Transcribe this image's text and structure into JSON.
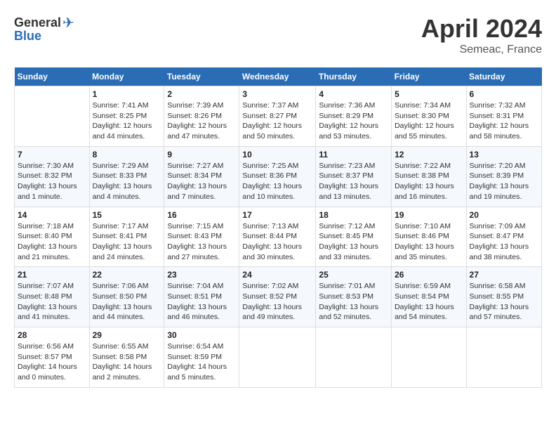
{
  "header": {
    "logo": {
      "general": "General",
      "blue": "Blue"
    },
    "month": "April 2024",
    "location": "Semeac, France"
  },
  "weekdays": [
    "Sunday",
    "Monday",
    "Tuesday",
    "Wednesday",
    "Thursday",
    "Friday",
    "Saturday"
  ],
  "weeks": [
    [
      {
        "day": "",
        "sunrise": "",
        "sunset": "",
        "daylight": ""
      },
      {
        "day": "1",
        "sunrise": "Sunrise: 7:41 AM",
        "sunset": "Sunset: 8:25 PM",
        "daylight": "Daylight: 12 hours and 44 minutes."
      },
      {
        "day": "2",
        "sunrise": "Sunrise: 7:39 AM",
        "sunset": "Sunset: 8:26 PM",
        "daylight": "Daylight: 12 hours and 47 minutes."
      },
      {
        "day": "3",
        "sunrise": "Sunrise: 7:37 AM",
        "sunset": "Sunset: 8:27 PM",
        "daylight": "Daylight: 12 hours and 50 minutes."
      },
      {
        "day": "4",
        "sunrise": "Sunrise: 7:36 AM",
        "sunset": "Sunset: 8:29 PM",
        "daylight": "Daylight: 12 hours and 53 minutes."
      },
      {
        "day": "5",
        "sunrise": "Sunrise: 7:34 AM",
        "sunset": "Sunset: 8:30 PM",
        "daylight": "Daylight: 12 hours and 55 minutes."
      },
      {
        "day": "6",
        "sunrise": "Sunrise: 7:32 AM",
        "sunset": "Sunset: 8:31 PM",
        "daylight": "Daylight: 12 hours and 58 minutes."
      }
    ],
    [
      {
        "day": "7",
        "sunrise": "Sunrise: 7:30 AM",
        "sunset": "Sunset: 8:32 PM",
        "daylight": "Daylight: 13 hours and 1 minute."
      },
      {
        "day": "8",
        "sunrise": "Sunrise: 7:29 AM",
        "sunset": "Sunset: 8:33 PM",
        "daylight": "Daylight: 13 hours and 4 minutes."
      },
      {
        "day": "9",
        "sunrise": "Sunrise: 7:27 AM",
        "sunset": "Sunset: 8:34 PM",
        "daylight": "Daylight: 13 hours and 7 minutes."
      },
      {
        "day": "10",
        "sunrise": "Sunrise: 7:25 AM",
        "sunset": "Sunset: 8:36 PM",
        "daylight": "Daylight: 13 hours and 10 minutes."
      },
      {
        "day": "11",
        "sunrise": "Sunrise: 7:23 AM",
        "sunset": "Sunset: 8:37 PM",
        "daylight": "Daylight: 13 hours and 13 minutes."
      },
      {
        "day": "12",
        "sunrise": "Sunrise: 7:22 AM",
        "sunset": "Sunset: 8:38 PM",
        "daylight": "Daylight: 13 hours and 16 minutes."
      },
      {
        "day": "13",
        "sunrise": "Sunrise: 7:20 AM",
        "sunset": "Sunset: 8:39 PM",
        "daylight": "Daylight: 13 hours and 19 minutes."
      }
    ],
    [
      {
        "day": "14",
        "sunrise": "Sunrise: 7:18 AM",
        "sunset": "Sunset: 8:40 PM",
        "daylight": "Daylight: 13 hours and 21 minutes."
      },
      {
        "day": "15",
        "sunrise": "Sunrise: 7:17 AM",
        "sunset": "Sunset: 8:41 PM",
        "daylight": "Daylight: 13 hours and 24 minutes."
      },
      {
        "day": "16",
        "sunrise": "Sunrise: 7:15 AM",
        "sunset": "Sunset: 8:43 PM",
        "daylight": "Daylight: 13 hours and 27 minutes."
      },
      {
        "day": "17",
        "sunrise": "Sunrise: 7:13 AM",
        "sunset": "Sunset: 8:44 PM",
        "daylight": "Daylight: 13 hours and 30 minutes."
      },
      {
        "day": "18",
        "sunrise": "Sunrise: 7:12 AM",
        "sunset": "Sunset: 8:45 PM",
        "daylight": "Daylight: 13 hours and 33 minutes."
      },
      {
        "day": "19",
        "sunrise": "Sunrise: 7:10 AM",
        "sunset": "Sunset: 8:46 PM",
        "daylight": "Daylight: 13 hours and 35 minutes."
      },
      {
        "day": "20",
        "sunrise": "Sunrise: 7:09 AM",
        "sunset": "Sunset: 8:47 PM",
        "daylight": "Daylight: 13 hours and 38 minutes."
      }
    ],
    [
      {
        "day": "21",
        "sunrise": "Sunrise: 7:07 AM",
        "sunset": "Sunset: 8:48 PM",
        "daylight": "Daylight: 13 hours and 41 minutes."
      },
      {
        "day": "22",
        "sunrise": "Sunrise: 7:06 AM",
        "sunset": "Sunset: 8:50 PM",
        "daylight": "Daylight: 13 hours and 44 minutes."
      },
      {
        "day": "23",
        "sunrise": "Sunrise: 7:04 AM",
        "sunset": "Sunset: 8:51 PM",
        "daylight": "Daylight: 13 hours and 46 minutes."
      },
      {
        "day": "24",
        "sunrise": "Sunrise: 7:02 AM",
        "sunset": "Sunset: 8:52 PM",
        "daylight": "Daylight: 13 hours and 49 minutes."
      },
      {
        "day": "25",
        "sunrise": "Sunrise: 7:01 AM",
        "sunset": "Sunset: 8:53 PM",
        "daylight": "Daylight: 13 hours and 52 minutes."
      },
      {
        "day": "26",
        "sunrise": "Sunrise: 6:59 AM",
        "sunset": "Sunset: 8:54 PM",
        "daylight": "Daylight: 13 hours and 54 minutes."
      },
      {
        "day": "27",
        "sunrise": "Sunrise: 6:58 AM",
        "sunset": "Sunset: 8:55 PM",
        "daylight": "Daylight: 13 hours and 57 minutes."
      }
    ],
    [
      {
        "day": "28",
        "sunrise": "Sunrise: 6:56 AM",
        "sunset": "Sunset: 8:57 PM",
        "daylight": "Daylight: 14 hours and 0 minutes."
      },
      {
        "day": "29",
        "sunrise": "Sunrise: 6:55 AM",
        "sunset": "Sunset: 8:58 PM",
        "daylight": "Daylight: 14 hours and 2 minutes."
      },
      {
        "day": "30",
        "sunrise": "Sunrise: 6:54 AM",
        "sunset": "Sunset: 8:59 PM",
        "daylight": "Daylight: 14 hours and 5 minutes."
      },
      {
        "day": "",
        "sunrise": "",
        "sunset": "",
        "daylight": ""
      },
      {
        "day": "",
        "sunrise": "",
        "sunset": "",
        "daylight": ""
      },
      {
        "day": "",
        "sunrise": "",
        "sunset": "",
        "daylight": ""
      },
      {
        "day": "",
        "sunrise": "",
        "sunset": "",
        "daylight": ""
      }
    ]
  ]
}
